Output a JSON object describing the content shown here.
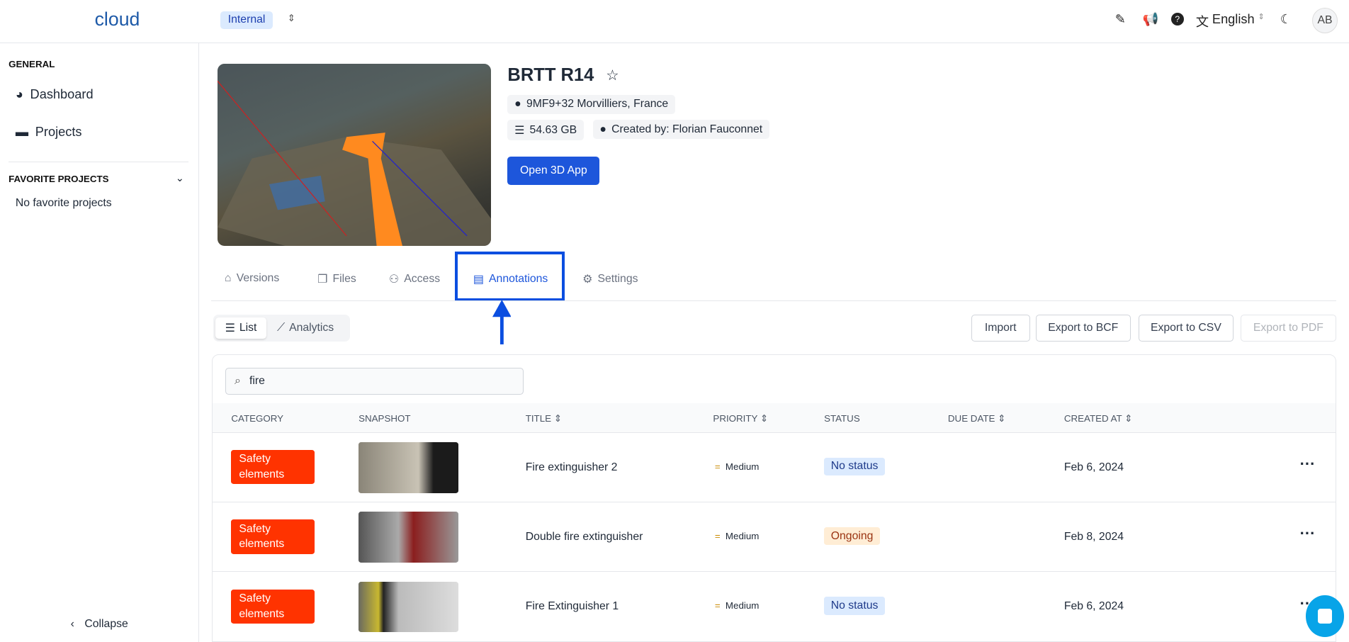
{
  "topbar": {
    "logo": "cloud",
    "org": "Internal",
    "language": "English",
    "avatar": "AB"
  },
  "sidebar": {
    "general": "GENERAL",
    "items": [
      {
        "label": "Dashboard",
        "icon": "pie-chart-icon"
      },
      {
        "label": "Projects",
        "icon": "folder-icon"
      }
    ],
    "favorites_title": "FAVORITE PROJECTS",
    "favorites_empty": "No favorite projects",
    "collapse": "Collapse"
  },
  "project": {
    "title": "BRTT R14",
    "location": "9MF9+32 Morvilliers, France",
    "size": "54.63 GB",
    "created_by": "Created by: Florian Fauconnet",
    "open_button": "Open 3D App"
  },
  "tabs": [
    {
      "label": "Versions"
    },
    {
      "label": "Files"
    },
    {
      "label": "Access"
    },
    {
      "label": "Annotations",
      "active": true
    },
    {
      "label": "Settings"
    }
  ],
  "views": {
    "list": "List",
    "analytics": "Analytics"
  },
  "actions": {
    "import": "Import",
    "bcf": "Export to BCF",
    "csv": "Export to CSV",
    "pdf": "Export to PDF"
  },
  "search": {
    "value": "fire"
  },
  "columns": [
    "CATEGORY",
    "SNAPSHOT",
    "TITLE",
    "PRIORITY",
    "STATUS",
    "DUE DATE",
    "CREATED AT"
  ],
  "rows": [
    {
      "category": "Safety elements",
      "title": "Fire extinguisher 2",
      "priority": "Medium",
      "status": "No status",
      "due": "",
      "created": "Feb 6, 2024"
    },
    {
      "category": "Safety elements",
      "title": "Double fire extinguisher",
      "priority": "Medium",
      "status": "Ongoing",
      "due": "",
      "created": "Feb 8, 2024"
    },
    {
      "category": "Safety elements",
      "title": "Fire Extinguisher 1",
      "priority": "Medium",
      "status": "No status",
      "due": "",
      "created": "Feb 6, 2024"
    }
  ],
  "colors": {
    "accent": "#1d56db",
    "category": "#ff3300",
    "highlight": "#0b4ee0"
  }
}
